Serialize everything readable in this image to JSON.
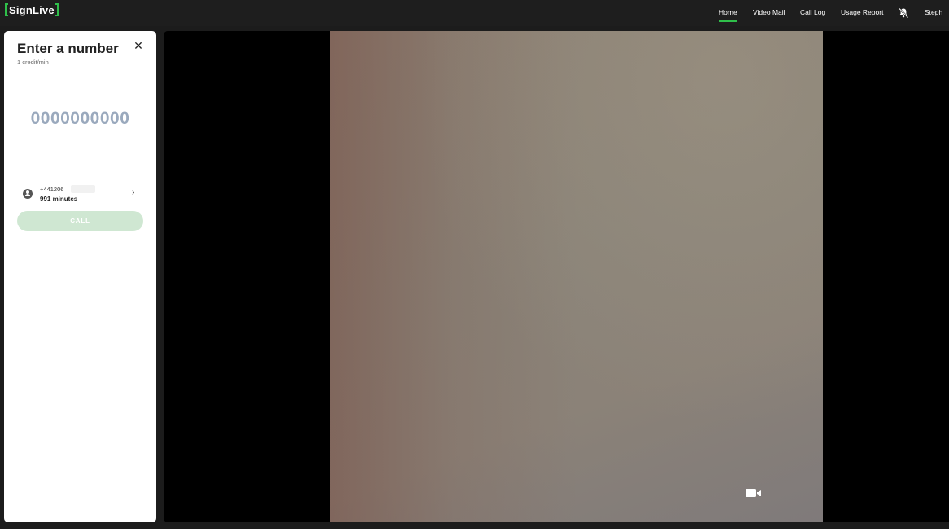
{
  "header": {
    "logo_text": "SignLive",
    "nav": [
      {
        "label": "Home",
        "active": true
      },
      {
        "label": "Video Mail",
        "active": false
      },
      {
        "label": "Call Log",
        "active": false
      },
      {
        "label": "Usage Report",
        "active": false
      }
    ],
    "notification_icon": "bell-slash-icon",
    "user_name": "Steph"
  },
  "panel": {
    "title": "Enter a number",
    "subtitle": "1 credit/min",
    "close_icon": "close-icon",
    "number_placeholder": "0000000000",
    "caller": {
      "number": "+441206",
      "minutes": "991 minutes",
      "icon": "user-circle-icon",
      "chevron_icon": "chevron-right-icon"
    },
    "call_label": "CALL"
  },
  "video": {
    "camera_icon": "video-camera-icon"
  },
  "colors": {
    "accent": "#2fbf4a",
    "call_button": "#cfe7d2",
    "number_placeholder": "#9aa9bd"
  }
}
